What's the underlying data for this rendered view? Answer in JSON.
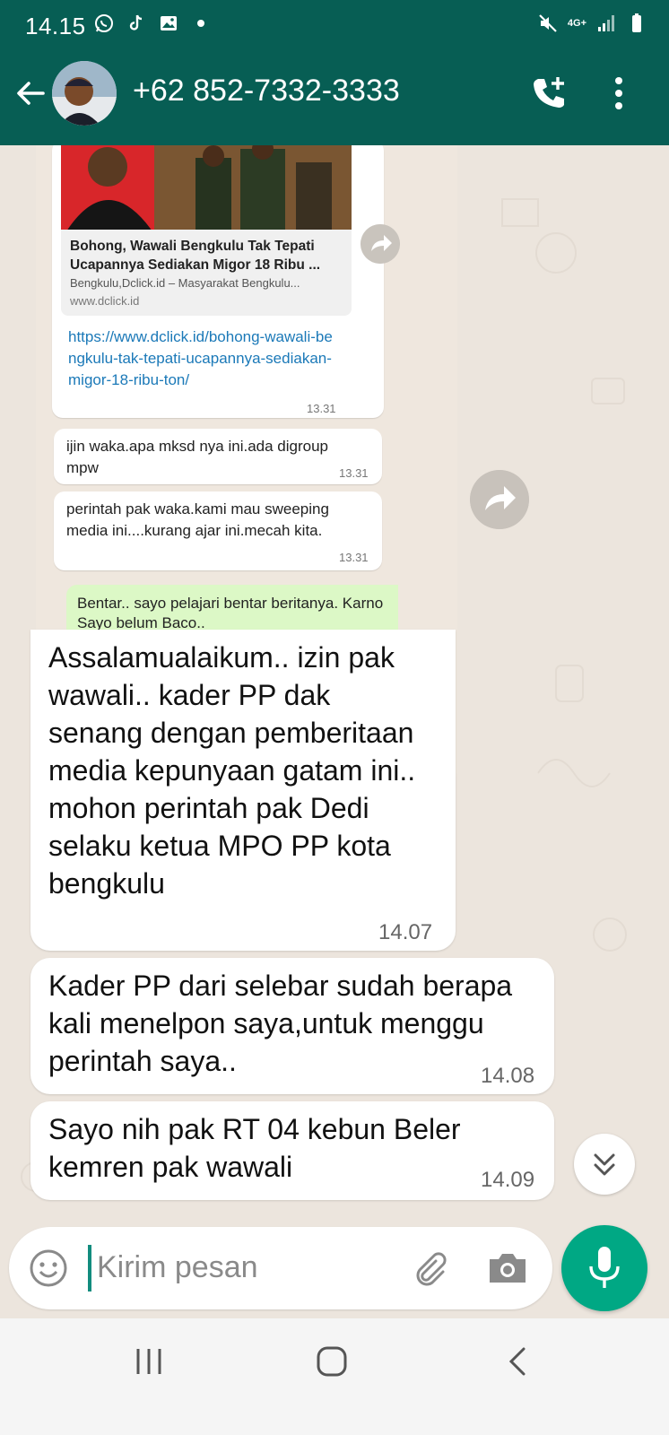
{
  "status_bar": {
    "time": "14.15",
    "network": "4G+"
  },
  "header": {
    "contact_name": "+62 852-7332-3333",
    "color": "#075e54"
  },
  "quoted": {
    "link_preview": {
      "title": "Bohong, Wawali Bengkulu Tak Tepati Ucapannya Sediakan Migor 18 Ribu ...",
      "description": "Bengkulu,Dclick.id – Masyarakat Bengkulu...",
      "domain": "www.dclick.id"
    },
    "link_text": "https://www.dclick.id/bohong-wawali-bengkulu-tak-tepati-ucapannya-sediakan-migor-18-ribu-ton/",
    "link_time": "13.31",
    "msg1_text": "ijin waka.apa mksd nya ini.ada digroup mpw",
    "msg1_time": "13.31",
    "msg2_text": "perintah pak waka.kami mau sweeping media ini....kurang ajar ini.mecah kita.",
    "msg2_time": "13.31",
    "reply_text": "Bentar.. sayo pelajari bentar beritanya. Karno Sayo belum Baco.."
  },
  "messages": [
    {
      "text": "Assalamualaikum.. izin pak wawali.. kader PP dak senang dengan pemberitaan media kepunyaan gatam ini.. mohon perintah pak Dedi selaku ketua MPO PP kota bengkulu",
      "time": "14.07"
    },
    {
      "text": "Kader PP dari selebar sudah berapa kali menelpon saya,untuk menggu perintah saya..",
      "time": "14.08"
    },
    {
      "text": "Sayo nih pak RT 04 kebun Beler kemren pak wawali",
      "time": "14.09"
    }
  ],
  "composer": {
    "placeholder": "Kirim pesan",
    "mic_color": "#00a884"
  },
  "icons": [
    "whatsapp-icon",
    "tiktok-icon",
    "gallery-icon",
    "mute-icon",
    "signal-icon",
    "battery-icon",
    "back-arrow-icon",
    "add-call-icon",
    "more-vert-icon",
    "forward-icon",
    "chevron-double-down-icon",
    "emoji-icon",
    "attach-icon",
    "camera-icon",
    "mic-icon",
    "recents-icon",
    "home-icon",
    "nav-back-icon"
  ]
}
